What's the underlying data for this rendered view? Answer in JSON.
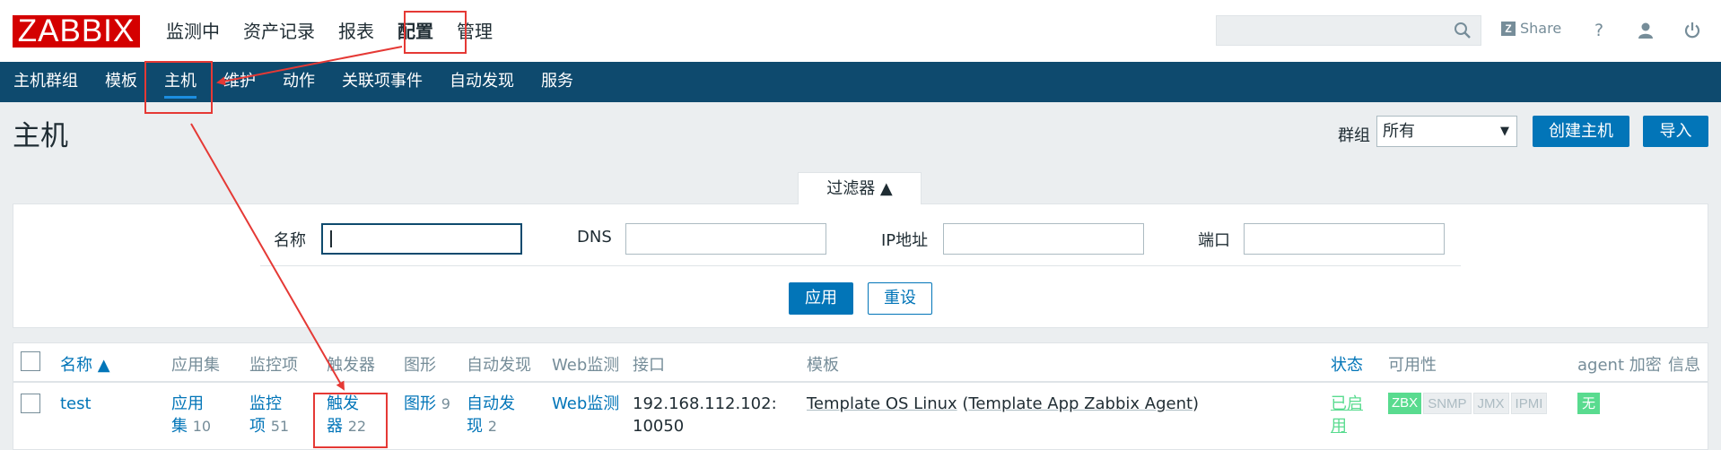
{
  "logo": "ZABBIX",
  "top_menu": [
    "监测中",
    "资产记录",
    "报表",
    "配置",
    "管理"
  ],
  "top_active": "配置",
  "search": {
    "value": "",
    "placeholder": ""
  },
  "share_label": "Share",
  "help_label": "?",
  "sub_menu": [
    "主机群组",
    "模板",
    "主机",
    "维护",
    "动作",
    "关联项事件",
    "自动发现",
    "服务"
  ],
  "sub_active": "主机",
  "page": {
    "title": "主机",
    "group_label": "群组",
    "group_value": "所有",
    "create_button": "创建主机",
    "import_button": "导入"
  },
  "filter": {
    "tab_label": "过滤器 ▲",
    "fields": [
      {
        "label": "名称",
        "value": ""
      },
      {
        "label": "DNS",
        "value": ""
      },
      {
        "label": "IP地址",
        "value": ""
      },
      {
        "label": "端口",
        "value": ""
      }
    ],
    "apply": "应用",
    "reset": "重设"
  },
  "table": {
    "headers": [
      "名称 ▲",
      "应用集",
      "监控项",
      "触发器",
      "图形",
      "自动发现",
      "Web监测",
      "接口",
      "模板",
      "状态",
      "可用性",
      "agent 加密",
      "信息"
    ],
    "rows": [
      {
        "name": "test",
        "apps": {
          "label_1": "应用",
          "label_2": "集",
          "count": "10"
        },
        "items": {
          "label_1": "监控",
          "label_2": "项",
          "count": "51"
        },
        "triggers": {
          "label_1": "触发",
          "label_2": "器",
          "count": "22"
        },
        "graphs": {
          "label": "图形",
          "count": "9"
        },
        "discovery": {
          "label_1": "自动发",
          "label_2": "现",
          "count": "2"
        },
        "web": "Web监测",
        "interface_1": "192.168.112.102:",
        "interface_2": "10050",
        "template_main": "Template OS Linux",
        "template_paren_open": " (",
        "template_sub": "Template App Zabbix Agent",
        "template_paren_close": ")",
        "status_1": "已启",
        "status_2": "用",
        "availability": [
          "ZBX",
          "SNMP",
          "JMX",
          "IPMI"
        ],
        "encryption": "无"
      }
    ]
  },
  "colors": {
    "brand_red": "#d40000",
    "nav_dark": "#0e4a6e",
    "primary_blue": "#0275b8",
    "green": "#59db8f",
    "annotation_red": "#e53935"
  }
}
